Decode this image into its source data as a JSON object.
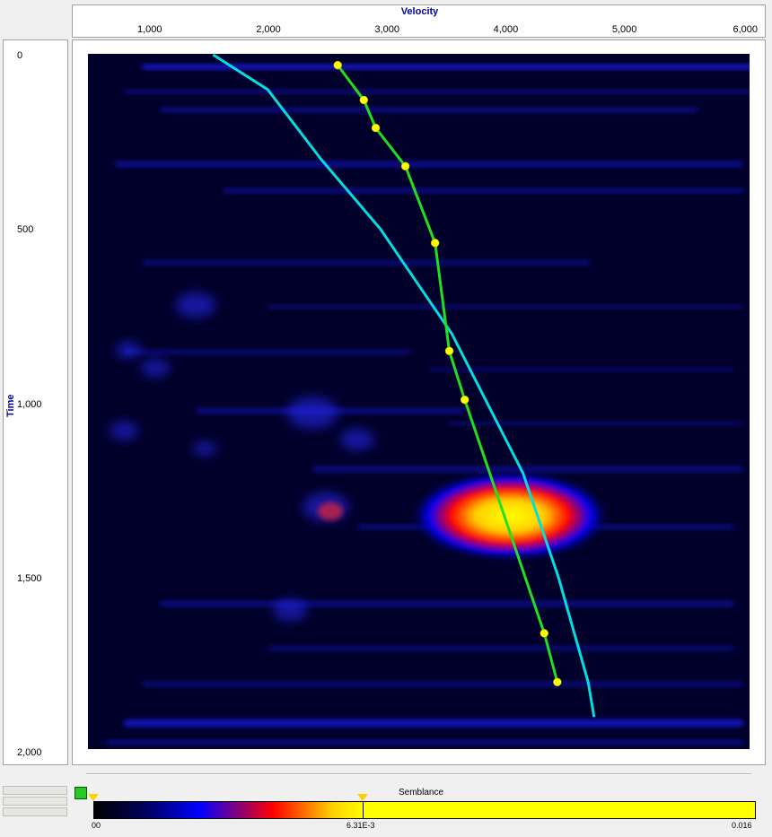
{
  "chart_data": {
    "type": "heatmap",
    "xlabel": "Velocity",
    "ylabel": "Time",
    "xlim": [
      500,
      6000
    ],
    "ylim": [
      2000,
      0
    ],
    "x_ticks": [
      "1,000",
      "2,000",
      "3,000",
      "4,000",
      "5,000",
      "6,000"
    ],
    "y_ticks": [
      "0",
      "500",
      "1,000",
      "1,500",
      "2,000"
    ],
    "colorbar": {
      "title": "Semblance",
      "min_label": "00",
      "max_label": "0.016",
      "marker_label": "6.31E-3",
      "colors": [
        "#000000",
        "#000060",
        "#0000ff",
        "#ff0000",
        "#ffd000",
        "#ffff00"
      ]
    },
    "series": [
      {
        "style": "cyan line",
        "color": "#00e0e0",
        "points": [
          [
            1540,
            0
          ],
          [
            2000,
            100
          ],
          [
            2450,
            300
          ],
          [
            2950,
            500
          ],
          [
            3550,
            800
          ],
          [
            4150,
            1200
          ],
          [
            4450,
            1500
          ],
          [
            4700,
            1800
          ],
          [
            4750,
            1900
          ]
        ]
      },
      {
        "style": "green picks with yellow markers",
        "color": "#20e020",
        "marker_color": "#ffff00",
        "points": [
          [
            2590,
            30
          ],
          [
            2810,
            130
          ],
          [
            2910,
            210
          ],
          [
            3160,
            320
          ],
          [
            3410,
            540
          ],
          [
            3530,
            850
          ],
          [
            3660,
            990
          ],
          [
            4330,
            1660
          ],
          [
            4440,
            1800
          ]
        ]
      }
    ]
  }
}
